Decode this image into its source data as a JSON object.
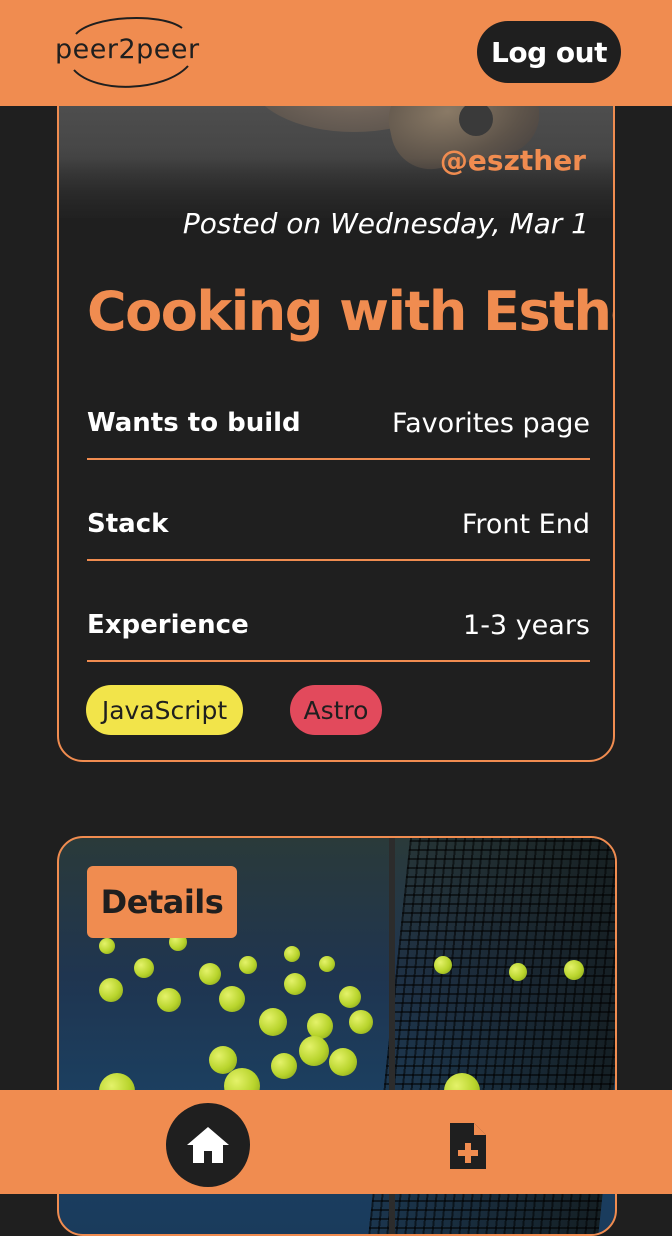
{
  "header": {
    "logo_text": "peer2peer",
    "logout_label": "Log out"
  },
  "card1": {
    "handle": "@eszther",
    "posted": "Posted on Wednesday, Mar 1",
    "title": "Cooking with Esther",
    "rows": [
      {
        "label": "Wants to build",
        "value": "Favorites page"
      },
      {
        "label": "Stack",
        "value": "Front End"
      },
      {
        "label": "Experience",
        "value": "1-3 years"
      }
    ],
    "tags": [
      {
        "label": "JavaScript",
        "color": "#f2e44a"
      },
      {
        "label": "Astro",
        "color": "#e24a5c"
      }
    ]
  },
  "card2": {
    "details_label": "Details"
  },
  "bottom_nav": {
    "home_icon": "home-icon",
    "add_icon": "add-document-icon"
  },
  "colors": {
    "accent": "#f08c50",
    "background": "#1f1f1f",
    "text": "#ffffff"
  }
}
